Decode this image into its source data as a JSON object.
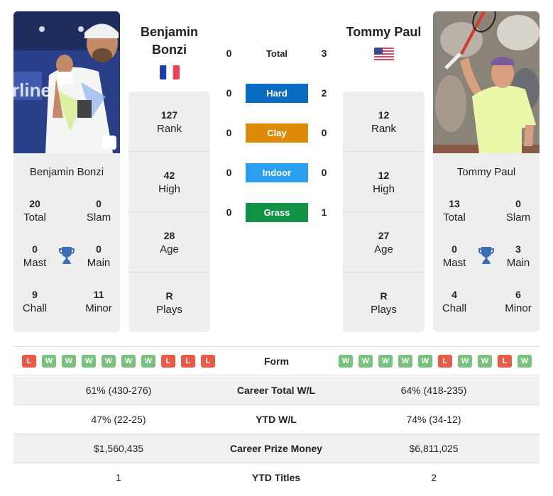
{
  "player1": {
    "name": "Benjamin Bonzi",
    "name_line1": "Benjamin",
    "name_line2": "Bonzi",
    "country_flag": "france-flag",
    "rank": "127",
    "rank_label": "Rank",
    "high": "42",
    "high_label": "High",
    "age": "28",
    "age_label": "Age",
    "plays": "R",
    "plays_label": "Plays",
    "titles": {
      "total": "20",
      "total_label": "Total",
      "slam": "0",
      "slam_label": "Slam",
      "mast": "0",
      "mast_label": "Mast",
      "main": "0",
      "main_label": "Main",
      "chall": "9",
      "chall_label": "Chall",
      "minor": "11",
      "minor_label": "Minor"
    },
    "form": [
      "L",
      "W",
      "W",
      "W",
      "W",
      "W",
      "W",
      "L",
      "L",
      "L"
    ]
  },
  "player2": {
    "name": "Tommy Paul",
    "country_flag": "usa-flag",
    "rank": "12",
    "rank_label": "Rank",
    "high": "12",
    "high_label": "High",
    "age": "27",
    "age_label": "Age",
    "plays": "R",
    "plays_label": "Plays",
    "titles": {
      "total": "13",
      "total_label": "Total",
      "slam": "0",
      "slam_label": "Slam",
      "mast": "0",
      "mast_label": "Mast",
      "main": "3",
      "main_label": "Main",
      "chall": "4",
      "chall_label": "Chall",
      "minor": "6",
      "minor_label": "Minor"
    },
    "form": [
      "W",
      "W",
      "W",
      "W",
      "W",
      "L",
      "W",
      "W",
      "L",
      "W"
    ]
  },
  "h2h": [
    {
      "label": "Total",
      "left": "0",
      "right": "3",
      "color": ""
    },
    {
      "label": "Hard",
      "left": "0",
      "right": "2",
      "color": "#0a6bc2"
    },
    {
      "label": "Clay",
      "left": "0",
      "right": "0",
      "color": "#de8b0a"
    },
    {
      "label": "Indoor",
      "left": "0",
      "right": "0",
      "color": "#2b9ff0"
    },
    {
      "label": "Grass",
      "left": "0",
      "right": "1",
      "color": "#119146"
    }
  ],
  "form_label": "Form",
  "stats": [
    {
      "label": "Career Total W/L",
      "left": "61% (430-276)",
      "right": "64% (418-235)"
    },
    {
      "label": "YTD W/L",
      "left": "47% (22-25)",
      "right": "74% (34-12)"
    },
    {
      "label": "Career Prize Money",
      "left": "$1,560,435",
      "right": "$6,811,025"
    },
    {
      "label": "YTD Titles",
      "left": "1",
      "right": "2"
    }
  ],
  "colors": {
    "win": "#78c27e",
    "loss": "#ea5a47",
    "card_bg": "#eeeeee",
    "trophy": "#3a6fb5"
  }
}
